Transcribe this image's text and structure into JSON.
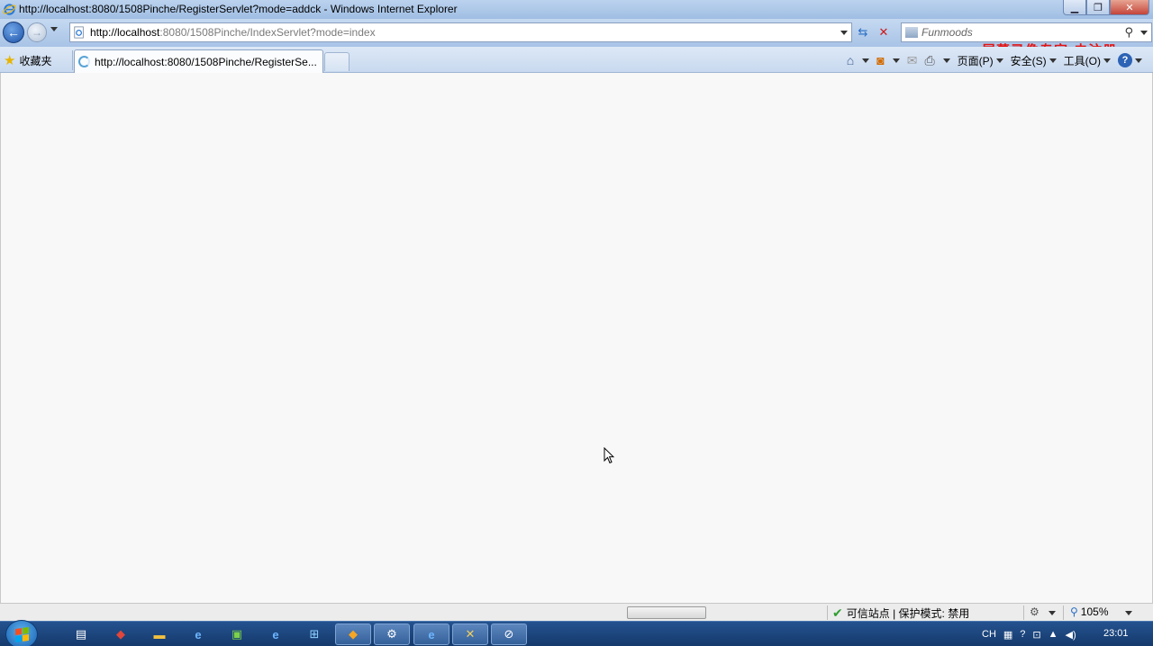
{
  "window": {
    "title": "http://localhost:8080/1508Pinche/RegisterServlet?mode=addck - Windows Internet Explorer",
    "minimize_icon": "minimize-icon",
    "maximize_icon": "maximize-icon",
    "close_icon": "close-icon"
  },
  "nav": {
    "address_host": "http://localhost",
    "address_rest": ":8080/1508Pinche/IndexServlet?mode=index",
    "search_placeholder": "Funmoods",
    "watermark": "屏幕录像专家  未注册"
  },
  "tabs": {
    "favorites_label": "收藏夹",
    "active_tab_title": "http://localhost:8080/1508Pinche/RegisterSe..."
  },
  "commandbar": {
    "page_label": "页面(P)",
    "safety_label": "安全(S)",
    "tools_label": "工具(O)"
  },
  "statusbar": {
    "zone_text": "可信站点 | 保护模式: 禁用",
    "zoom_text": "105%"
  },
  "taskbar": {
    "input_lang": "CH",
    "clock": "23:01"
  },
  "colors": {
    "titlebar": "#bcd3ee",
    "watermark": "#e31414",
    "taskbar": "#1e4a84"
  }
}
